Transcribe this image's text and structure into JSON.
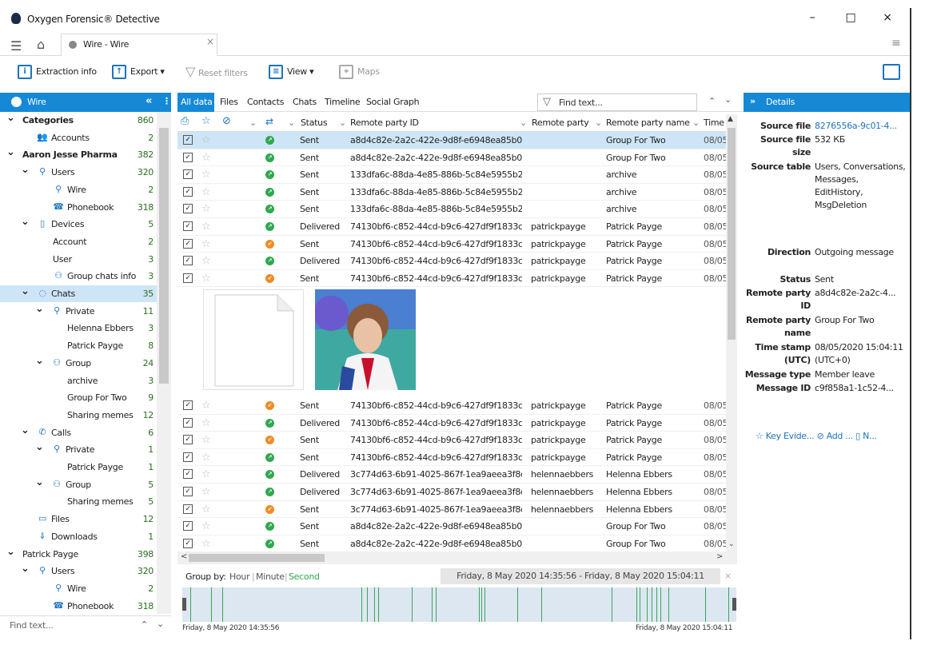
{
  "window": {
    "title": "Oxygen Forensic® Detective",
    "minimize": "–",
    "maximize": "□",
    "close": "×"
  },
  "tab": {
    "label": "Wire - Wire",
    "close": "×"
  },
  "toolbar": {
    "extraction": "Extraction info",
    "export": "Export",
    "reset": "Reset filters",
    "view": "View",
    "maps": "Maps"
  },
  "left": {
    "title": "Wire",
    "collapse": "«",
    "tree": [
      {
        "label": "Categories",
        "count": "860",
        "lvl": 0,
        "chev": "v",
        "bold": true
      },
      {
        "label": "Accounts",
        "count": "2",
        "lvl": 1,
        "icon": "accounts-icon"
      },
      {
        "label": "Aaron Jesse Pharma",
        "count": "382",
        "lvl": 0,
        "chev": "v",
        "bold": true
      },
      {
        "label": "Users",
        "count": "320",
        "lvl": 1,
        "chev": "v",
        "icon": "user-icon"
      },
      {
        "label": "Wire",
        "count": "2",
        "lvl": 2,
        "icon": "user-icon"
      },
      {
        "label": "Phonebook",
        "count": "318",
        "lvl": 2,
        "icon": "phonebook-icon"
      },
      {
        "label": "Devices",
        "count": "5",
        "lvl": 1,
        "chev": "v",
        "icon": "device-icon"
      },
      {
        "label": "Account",
        "count": "2",
        "lvl": 2
      },
      {
        "label": "User",
        "count": "3",
        "lvl": 2
      },
      {
        "label": "Group chats info",
        "count": "3",
        "lvl": 2,
        "icon": "group-icon"
      },
      {
        "label": "Chats",
        "count": "35",
        "lvl": 1,
        "chev": "v",
        "icon": "chat-icon",
        "sel": true
      },
      {
        "label": "Private",
        "count": "11",
        "lvl": 2,
        "chev": "v",
        "icon": "user-icon"
      },
      {
        "label": "Helenna Ebbers",
        "count": "3",
        "lvl": 3
      },
      {
        "label": "Patrick Payge",
        "count": "8",
        "lvl": 3
      },
      {
        "label": "Group",
        "count": "24",
        "lvl": 2,
        "chev": "v",
        "icon": "group-icon"
      },
      {
        "label": "archive",
        "count": "3",
        "lvl": 3
      },
      {
        "label": "Group For Two",
        "count": "9",
        "lvl": 3
      },
      {
        "label": "Sharing memes",
        "count": "12",
        "lvl": 3
      },
      {
        "label": "Calls",
        "count": "6",
        "lvl": 1,
        "chev": "v",
        "icon": "phone-icon"
      },
      {
        "label": "Private",
        "count": "1",
        "lvl": 2,
        "chev": "v",
        "icon": "user-icon"
      },
      {
        "label": "Patrick Payge",
        "count": "1",
        "lvl": 3
      },
      {
        "label": "Group",
        "count": "5",
        "lvl": 2,
        "chev": "v",
        "icon": "group-icon"
      },
      {
        "label": "Sharing memes",
        "count": "5",
        "lvl": 3
      },
      {
        "label": "Files",
        "count": "12",
        "lvl": 1,
        "icon": "file-icon"
      },
      {
        "label": "Downloads",
        "count": "1",
        "lvl": 1,
        "icon": "download-icon"
      },
      {
        "label": "Patrick Payge",
        "count": "398",
        "lvl": 0,
        "chev": "v"
      },
      {
        "label": "Users",
        "count": "320",
        "lvl": 1,
        "chev": "v",
        "icon": "user-icon"
      },
      {
        "label": "Wire",
        "count": "2",
        "lvl": 2,
        "icon": "user-icon"
      },
      {
        "label": "Phonebook",
        "count": "318",
        "lvl": 2,
        "icon": "phonebook-icon"
      }
    ],
    "find_placeholder": "Find text..."
  },
  "center": {
    "tabs": [
      "All data",
      "Files",
      "Contacts",
      "Chats",
      "Timeline",
      "Social Graph"
    ],
    "find_placeholder": "Find text...",
    "columns": {
      "status": "Status",
      "remote_id": "Remote party ID",
      "remote_party": "Remote party",
      "remote_name": "Remote party name",
      "time": "Time"
    },
    "rows": [
      {
        "dir": "out",
        "status": "Sent",
        "id": "a8d4c82e-2a2c-422e-9d8f-e6948ea85b0b",
        "party": "",
        "name": "Group For Two",
        "time": "08/05",
        "sel": true
      },
      {
        "dir": "out",
        "status": "Sent",
        "id": "a8d4c82e-2a2c-422e-9d8f-e6948ea85b0b",
        "party": "",
        "name": "Group For Two",
        "time": "08/05"
      },
      {
        "dir": "out",
        "status": "Sent",
        "id": "133dfa6c-88da-4e85-886b-5c84e5955b2a",
        "party": "",
        "name": "archive",
        "time": "08/05"
      },
      {
        "dir": "out",
        "status": "Sent",
        "id": "133dfa6c-88da-4e85-886b-5c84e5955b2a",
        "party": "",
        "name": "archive",
        "time": "08/05"
      },
      {
        "dir": "out",
        "status": "Sent",
        "id": "133dfa6c-88da-4e85-886b-5c84e5955b2a",
        "party": "",
        "name": "archive",
        "time": "08/05"
      },
      {
        "dir": "out",
        "status": "Delivered",
        "id": "74130bf6-c852-44cd-b9c6-427df9f1833c",
        "party": "patrickpayge",
        "name": "Patrick Payge",
        "time": "08/05"
      },
      {
        "dir": "in",
        "status": "Sent",
        "id": "74130bf6-c852-44cd-b9c6-427df9f1833c",
        "party": "patrickpayge",
        "name": "Patrick Payge",
        "time": "08/05"
      },
      {
        "dir": "out",
        "status": "Delivered",
        "id": "74130bf6-c852-44cd-b9c6-427df9f1833c",
        "party": "patrickpayge",
        "name": "Patrick Payge",
        "time": "08/05"
      },
      {
        "dir": "in",
        "status": "Sent",
        "id": "74130bf6-c852-44cd-b9c6-427df9f1833c",
        "party": "patrickpayge",
        "name": "Patrick Payge",
        "time": "08/05"
      }
    ],
    "rows2": [
      {
        "dir": "in",
        "status": "Sent",
        "id": "74130bf6-c852-44cd-b9c6-427df9f1833c",
        "party": "patrickpayge",
        "name": "Patrick Payge",
        "time": "08/05"
      },
      {
        "dir": "out",
        "status": "Delivered",
        "id": "74130bf6-c852-44cd-b9c6-427df9f1833c",
        "party": "patrickpayge",
        "name": "Patrick Payge",
        "time": "08/05"
      },
      {
        "dir": "in",
        "status": "Sent",
        "id": "74130bf6-c852-44cd-b9c6-427df9f1833c",
        "party": "patrickpayge",
        "name": "Patrick Payge",
        "time": "08/05"
      },
      {
        "dir": "out",
        "status": "Sent",
        "id": "74130bf6-c852-44cd-b9c6-427df9f1833c",
        "party": "patrickpayge",
        "name": "Patrick Payge",
        "time": "08/05"
      },
      {
        "dir": "out",
        "status": "Delivered",
        "id": "3c774d63-6b91-4025-867f-1ea9aeea3f8d",
        "party": "helennaebbers",
        "name": "Helenna Ebbers",
        "time": "08/05"
      },
      {
        "dir": "out",
        "status": "Delivered",
        "id": "3c774d63-6b91-4025-867f-1ea9aeea3f8d",
        "party": "helennaebbers",
        "name": "Helenna Ebbers",
        "time": "08/05"
      },
      {
        "dir": "in",
        "status": "Sent",
        "id": "3c774d63-6b91-4025-867f-1ea9aeea3f8d",
        "party": "helennaebbers",
        "name": "Helenna Ebbers",
        "time": "08/05"
      },
      {
        "dir": "out",
        "status": "Sent",
        "id": "a8d4c82e-2a2c-422e-9d8f-e6948ea85b0b",
        "party": "",
        "name": "Group For Two",
        "time": "08/05"
      },
      {
        "dir": "out",
        "status": "Sent",
        "id": "a8d4c82e-2a2c-422e-9d8f-e6948ea85b0b",
        "party": "",
        "name": "Group For Two",
        "time": "08/05"
      }
    ],
    "timeline": {
      "group_by": "Group by:",
      "hour": "Hour",
      "minute": "Minute",
      "second": "Second",
      "range": "Friday, 8 May 2020 14:35:56 - Friday, 8 May 2020 15:04:11",
      "start": "Friday, 8 May 2020 14:35:56",
      "end": "Friday, 8 May 2020 15:04:11",
      "ticks": [
        0.015,
        0.052,
        0.072,
        0.323,
        0.333,
        0.346,
        0.353,
        0.414,
        0.45,
        0.457,
        0.535,
        0.539,
        0.545,
        0.604,
        0.648,
        0.775,
        0.819,
        0.825,
        0.838,
        0.847,
        0.856,
        0.863,
        0.877,
        0.944,
        0.985
      ]
    }
  },
  "details": {
    "title": "Details",
    "fields": [
      {
        "k": "Source file",
        "v": "8276556a-9c01-4...",
        "link": true
      },
      {
        "k": "Source file size",
        "v": "532 КБ"
      },
      {
        "k": "Source table",
        "v": "Users, Conversations, Messages, EditHistory, MsgDeletion"
      },
      {
        "k": "Direction",
        "v": "Outgoing message"
      },
      {
        "k": "Status",
        "v": "Sent"
      },
      {
        "k": "Remote party ID",
        "v": "a8d4c82e-2a2c-4..."
      },
      {
        "k": "Remote party name",
        "v": "Group For Two"
      },
      {
        "k": "Time stamp (UTC)",
        "v": "08/05/2020 15:04:11 (UTC+0)"
      },
      {
        "k": "Message type",
        "v": "Member leave"
      },
      {
        "k": "Message ID",
        "v": "c9f858a1-1c52-4..."
      }
    ],
    "actions": {
      "key": "Key Evide...",
      "add": "Add ...",
      "note": "N..."
    }
  },
  "colors": {
    "accent": "#1589d6",
    "outgoing": "#2fa84f",
    "incoming": "#f08a24"
  }
}
